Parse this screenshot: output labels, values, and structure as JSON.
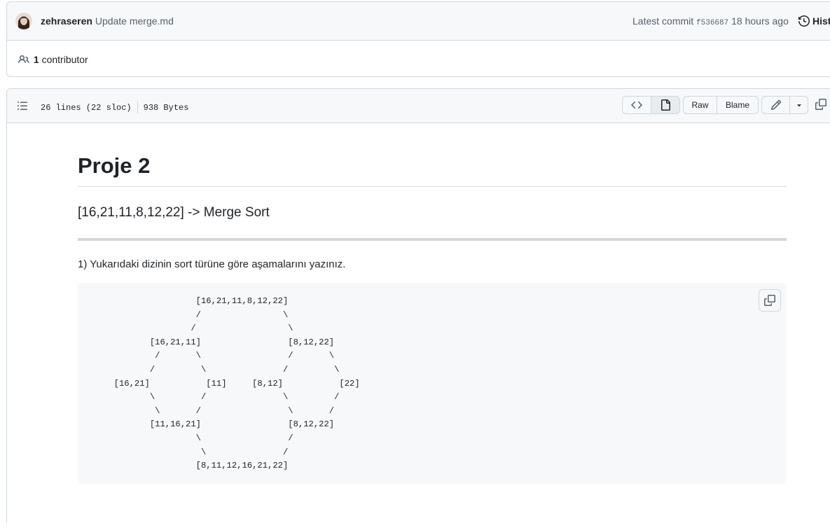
{
  "commit": {
    "author": "zehraseren",
    "message": "Update merge.md",
    "latest_label": "Latest commit",
    "sha": "f536687",
    "time": "18 hours ago",
    "history_label": "History"
  },
  "contributors": {
    "count": "1",
    "label": "contributor"
  },
  "file": {
    "lines": "26 lines (22 sloc)",
    "size": "938 Bytes",
    "raw_label": "Raw",
    "blame_label": "Blame"
  },
  "markdown": {
    "title": "Proje 2",
    "subtitle": "[16,21,11,8,12,22] -> Merge Sort",
    "paragraph": "1) Yukarıdaki dizinin sort türüne göre aşamalarını yazınız.",
    "code": "                  [16,21,11,8,12,22]\n                  /                \\\n                 /                  \\\n         [16,21,11]                 [8,12,22]\n          /       \\                 /       \\\n         /         \\               /         \\\n  [16,21]           [11]     [8,12]           [22]\n         \\         /               \\         /\n          \\       /                 \\       /\n         [11,16,21]                 [8,12,22]\n                  \\                 /\n                   \\               /\n                  [8,11,12,16,21,22]"
  },
  "icons": {
    "history": "history-icon",
    "people": "people-icon",
    "toc": "list-icon",
    "code_view": "code-icon",
    "preview": "file-icon",
    "edit": "pencil-icon",
    "dropdown": "triangle-down-icon",
    "copy": "copy-icon"
  }
}
